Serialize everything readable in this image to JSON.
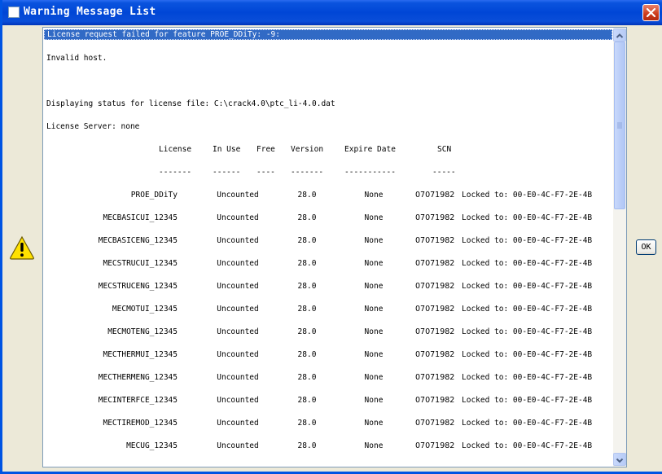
{
  "window": {
    "title": "Warning Message List"
  },
  "message": {
    "highlighted_line": "License request failed for feature PROE_DDiTy: -9:",
    "error_text": "Invalid host.",
    "status_line": "Displaying status for license file: C:\\crack4.0\\ptc_li-4.0.dat",
    "server_line": "License Server: none"
  },
  "table": {
    "headers": {
      "license": "License",
      "in_use": "In Use",
      "free": "Free",
      "version": "Version",
      "expire": "Expire Date",
      "scn": "SCN"
    },
    "underlines": {
      "license": "-------",
      "in_use": "------",
      "free": "----",
      "version": "-------",
      "expire": "-----------",
      "scn": "-----"
    },
    "rows": [
      {
        "license": "PROE_DDiTy",
        "in_use": "Uncounted",
        "version": "28.0",
        "expire": "None",
        "scn": "07071982",
        "locked": "Locked to: 00-E0-4C-F7-2E-4B"
      },
      {
        "license": "MECBASICUI_12345",
        "in_use": "Uncounted",
        "version": "28.0",
        "expire": "None",
        "scn": "07071982",
        "locked": "Locked to: 00-E0-4C-F7-2E-4B"
      },
      {
        "license": "MECBASICENG_12345",
        "in_use": "Uncounted",
        "version": "28.0",
        "expire": "None",
        "scn": "07071982",
        "locked": "Locked to: 00-E0-4C-F7-2E-4B"
      },
      {
        "license": "MECSTRUCUI_12345",
        "in_use": "Uncounted",
        "version": "28.0",
        "expire": "None",
        "scn": "07071982",
        "locked": "Locked to: 00-E0-4C-F7-2E-4B"
      },
      {
        "license": "MECSTRUCENG_12345",
        "in_use": "Uncounted",
        "version": "28.0",
        "expire": "None",
        "scn": "07071982",
        "locked": "Locked to: 00-E0-4C-F7-2E-4B"
      },
      {
        "license": "MECMOTUI_12345",
        "in_use": "Uncounted",
        "version": "28.0",
        "expire": "None",
        "scn": "07071982",
        "locked": "Locked to: 00-E0-4C-F7-2E-4B"
      },
      {
        "license": "MECMOTENG_12345",
        "in_use": "Uncounted",
        "version": "28.0",
        "expire": "None",
        "scn": "07071982",
        "locked": "Locked to: 00-E0-4C-F7-2E-4B"
      },
      {
        "license": "MECTHERMUI_12345",
        "in_use": "Uncounted",
        "version": "28.0",
        "expire": "None",
        "scn": "07071982",
        "locked": "Locked to: 00-E0-4C-F7-2E-4B"
      },
      {
        "license": "MECTHERMENG_12345",
        "in_use": "Uncounted",
        "version": "28.0",
        "expire": "None",
        "scn": "07071982",
        "locked": "Locked to: 00-E0-4C-F7-2E-4B"
      },
      {
        "license": "MECINTERFCE_12345",
        "in_use": "Uncounted",
        "version": "28.0",
        "expire": "None",
        "scn": "07071982",
        "locked": "Locked to: 00-E0-4C-F7-2E-4B"
      },
      {
        "license": "MECTIREMOD_12345",
        "in_use": "Uncounted",
        "version": "28.0",
        "expire": "None",
        "scn": "07071982",
        "locked": "Locked to: 00-E0-4C-F7-2E-4B"
      },
      {
        "license": "MECUG_12345",
        "in_use": "Uncounted",
        "version": "28.0",
        "expire": "None",
        "scn": "07071982",
        "locked": "Locked to: 00-E0-4C-F7-2E-4B"
      }
    ]
  },
  "buttons": {
    "ok": "OK"
  },
  "colors": {
    "selection": "#316ac5",
    "titlebar": "#0046d6",
    "close": "#cc3a1b"
  }
}
